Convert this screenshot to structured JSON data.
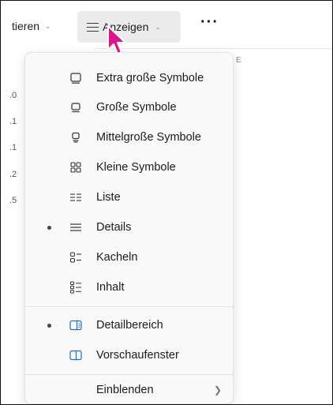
{
  "toolbar": {
    "sort_label": "tieren",
    "view_label": "Anzeigen",
    "more_label": "···"
  },
  "background": {
    "numbers": [
      ".0",
      ".1",
      ".1",
      ".2",
      ".5"
    ],
    "column_fragment": "E"
  },
  "menu": {
    "items": [
      {
        "label": "Extra große Symbole",
        "icon": "extra-large-icons-icon"
      },
      {
        "label": "Große Symbole",
        "icon": "large-icons-icon"
      },
      {
        "label": "Mittelgroße Symbole",
        "icon": "medium-icons-icon"
      },
      {
        "label": "Kleine Symbole",
        "icon": "small-icons-icon"
      },
      {
        "label": "Liste",
        "icon": "list-icon"
      },
      {
        "label": "Details",
        "icon": "details-icon",
        "selected": true
      },
      {
        "label": "Kacheln",
        "icon": "tiles-icon"
      },
      {
        "label": "Inhalt",
        "icon": "content-icon"
      }
    ],
    "panes": [
      {
        "label": "Detailbereich",
        "icon": "details-pane-icon",
        "selected": true
      },
      {
        "label": "Vorschaufenster",
        "icon": "preview-pane-icon"
      }
    ],
    "show": {
      "label": "Einblenden",
      "icon": "chevron-right-icon"
    }
  },
  "colors": {
    "cursor": "#e0148c",
    "pane_icon": "#1f6fc4",
    "menu_bg": "#f9f9f9"
  }
}
